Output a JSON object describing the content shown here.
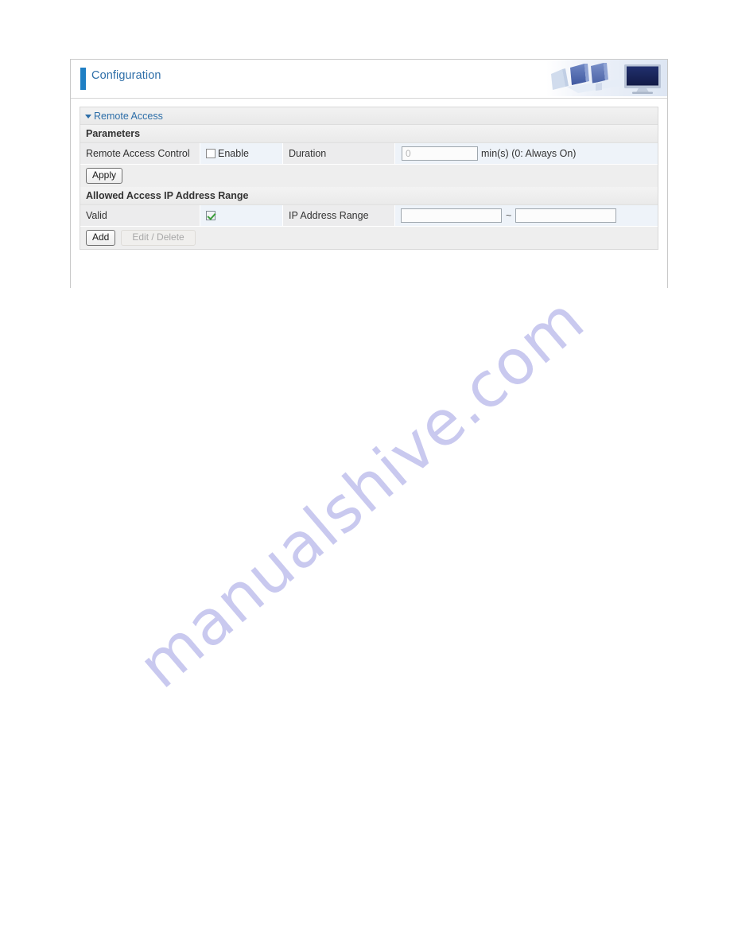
{
  "watermark": {
    "text": "manualshive.com"
  },
  "banner": {
    "title": "Configuration",
    "accent_color": "#1f7fc4",
    "art_icon": "computers-banner-image"
  },
  "section": {
    "title": "Remote Access",
    "collapse_icon": "triangle-down-icon"
  },
  "parameters": {
    "group_title": "Parameters",
    "remote_access_control_label": "Remote Access Control",
    "enable_label": "Enable",
    "enable_checked": false,
    "duration_label": "Duration",
    "duration_value": "0",
    "duration_suffix": "min(s) (0: Always On)",
    "apply_label": "Apply"
  },
  "allowed_range": {
    "group_title": "Allowed Access IP Address Range",
    "valid_label": "Valid",
    "valid_checked": true,
    "ip_range_label": "IP Address Range",
    "ip_start_value": "",
    "ip_end_value": "",
    "separator": "~",
    "add_label": "Add",
    "edit_delete_label": "Edit / Delete"
  }
}
